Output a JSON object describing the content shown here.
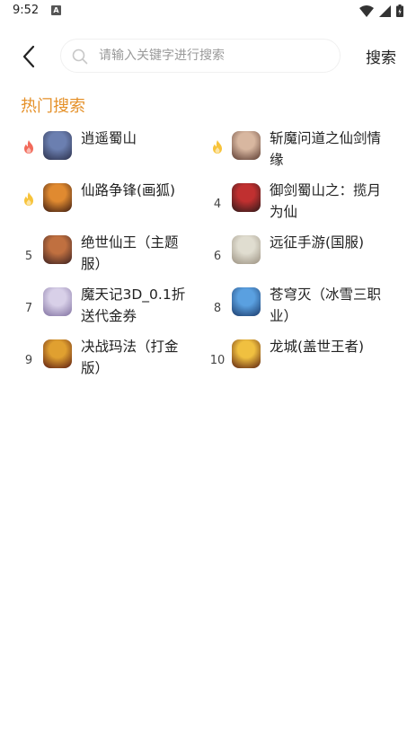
{
  "status_bar": {
    "time": "9:52",
    "notification_badge": "A"
  },
  "header": {
    "search_placeholder": "请输入关键字进行搜索",
    "search_button": "搜索"
  },
  "section_title": "热门搜索",
  "colors": {
    "accent": "#e5912a",
    "flame_red": "#f26a5a",
    "flame_yellow": "#f7c33a"
  },
  "hot_items": [
    {
      "rank": "",
      "rank_icon": "flame-red-icon",
      "name": "逍遥蜀山",
      "avatar_colors": [
        "#6b7fb0",
        "#2b2f4a"
      ]
    },
    {
      "rank": "",
      "rank_icon": "flame-yellow-icon",
      "name": "斩魔问道之仙剑情缘",
      "avatar_colors": [
        "#d8b7a0",
        "#5a3a30"
      ]
    },
    {
      "rank": "",
      "rank_icon": "flame-yellow-icon",
      "name": "仙路争锋(画狐)",
      "avatar_colors": [
        "#e08a30",
        "#3a1a10"
      ]
    },
    {
      "rank": "4",
      "rank_icon": "",
      "name": "御剑蜀山之：揽月为仙",
      "avatar_colors": [
        "#c03030",
        "#2a1a1a"
      ]
    },
    {
      "rank": "5",
      "rank_icon": "",
      "name": "绝世仙王（主题服）",
      "avatar_colors": [
        "#c07040",
        "#3a2020"
      ]
    },
    {
      "rank": "6",
      "rank_icon": "",
      "name": "远征手游(国服)",
      "avatar_colors": [
        "#e0ddd0",
        "#9a9080"
      ]
    },
    {
      "rank": "7",
      "rank_icon": "",
      "name": "魔天记3D_0.1折送代金券",
      "avatar_colors": [
        "#d8d0e8",
        "#8070a0"
      ]
    },
    {
      "rank": "8",
      "rank_icon": "",
      "name": "苍穹灭（冰雪三职业）",
      "avatar_colors": [
        "#5aa0e0",
        "#1a3a6a"
      ]
    },
    {
      "rank": "9",
      "rank_icon": "",
      "name": "决战玛法（打金版）",
      "avatar_colors": [
        "#e0a030",
        "#5a1a10"
      ]
    },
    {
      "rank": "10",
      "rank_icon": "",
      "name": "龙城(盖世王者)",
      "avatar_colors": [
        "#f0c040",
        "#5a2010"
      ]
    }
  ]
}
